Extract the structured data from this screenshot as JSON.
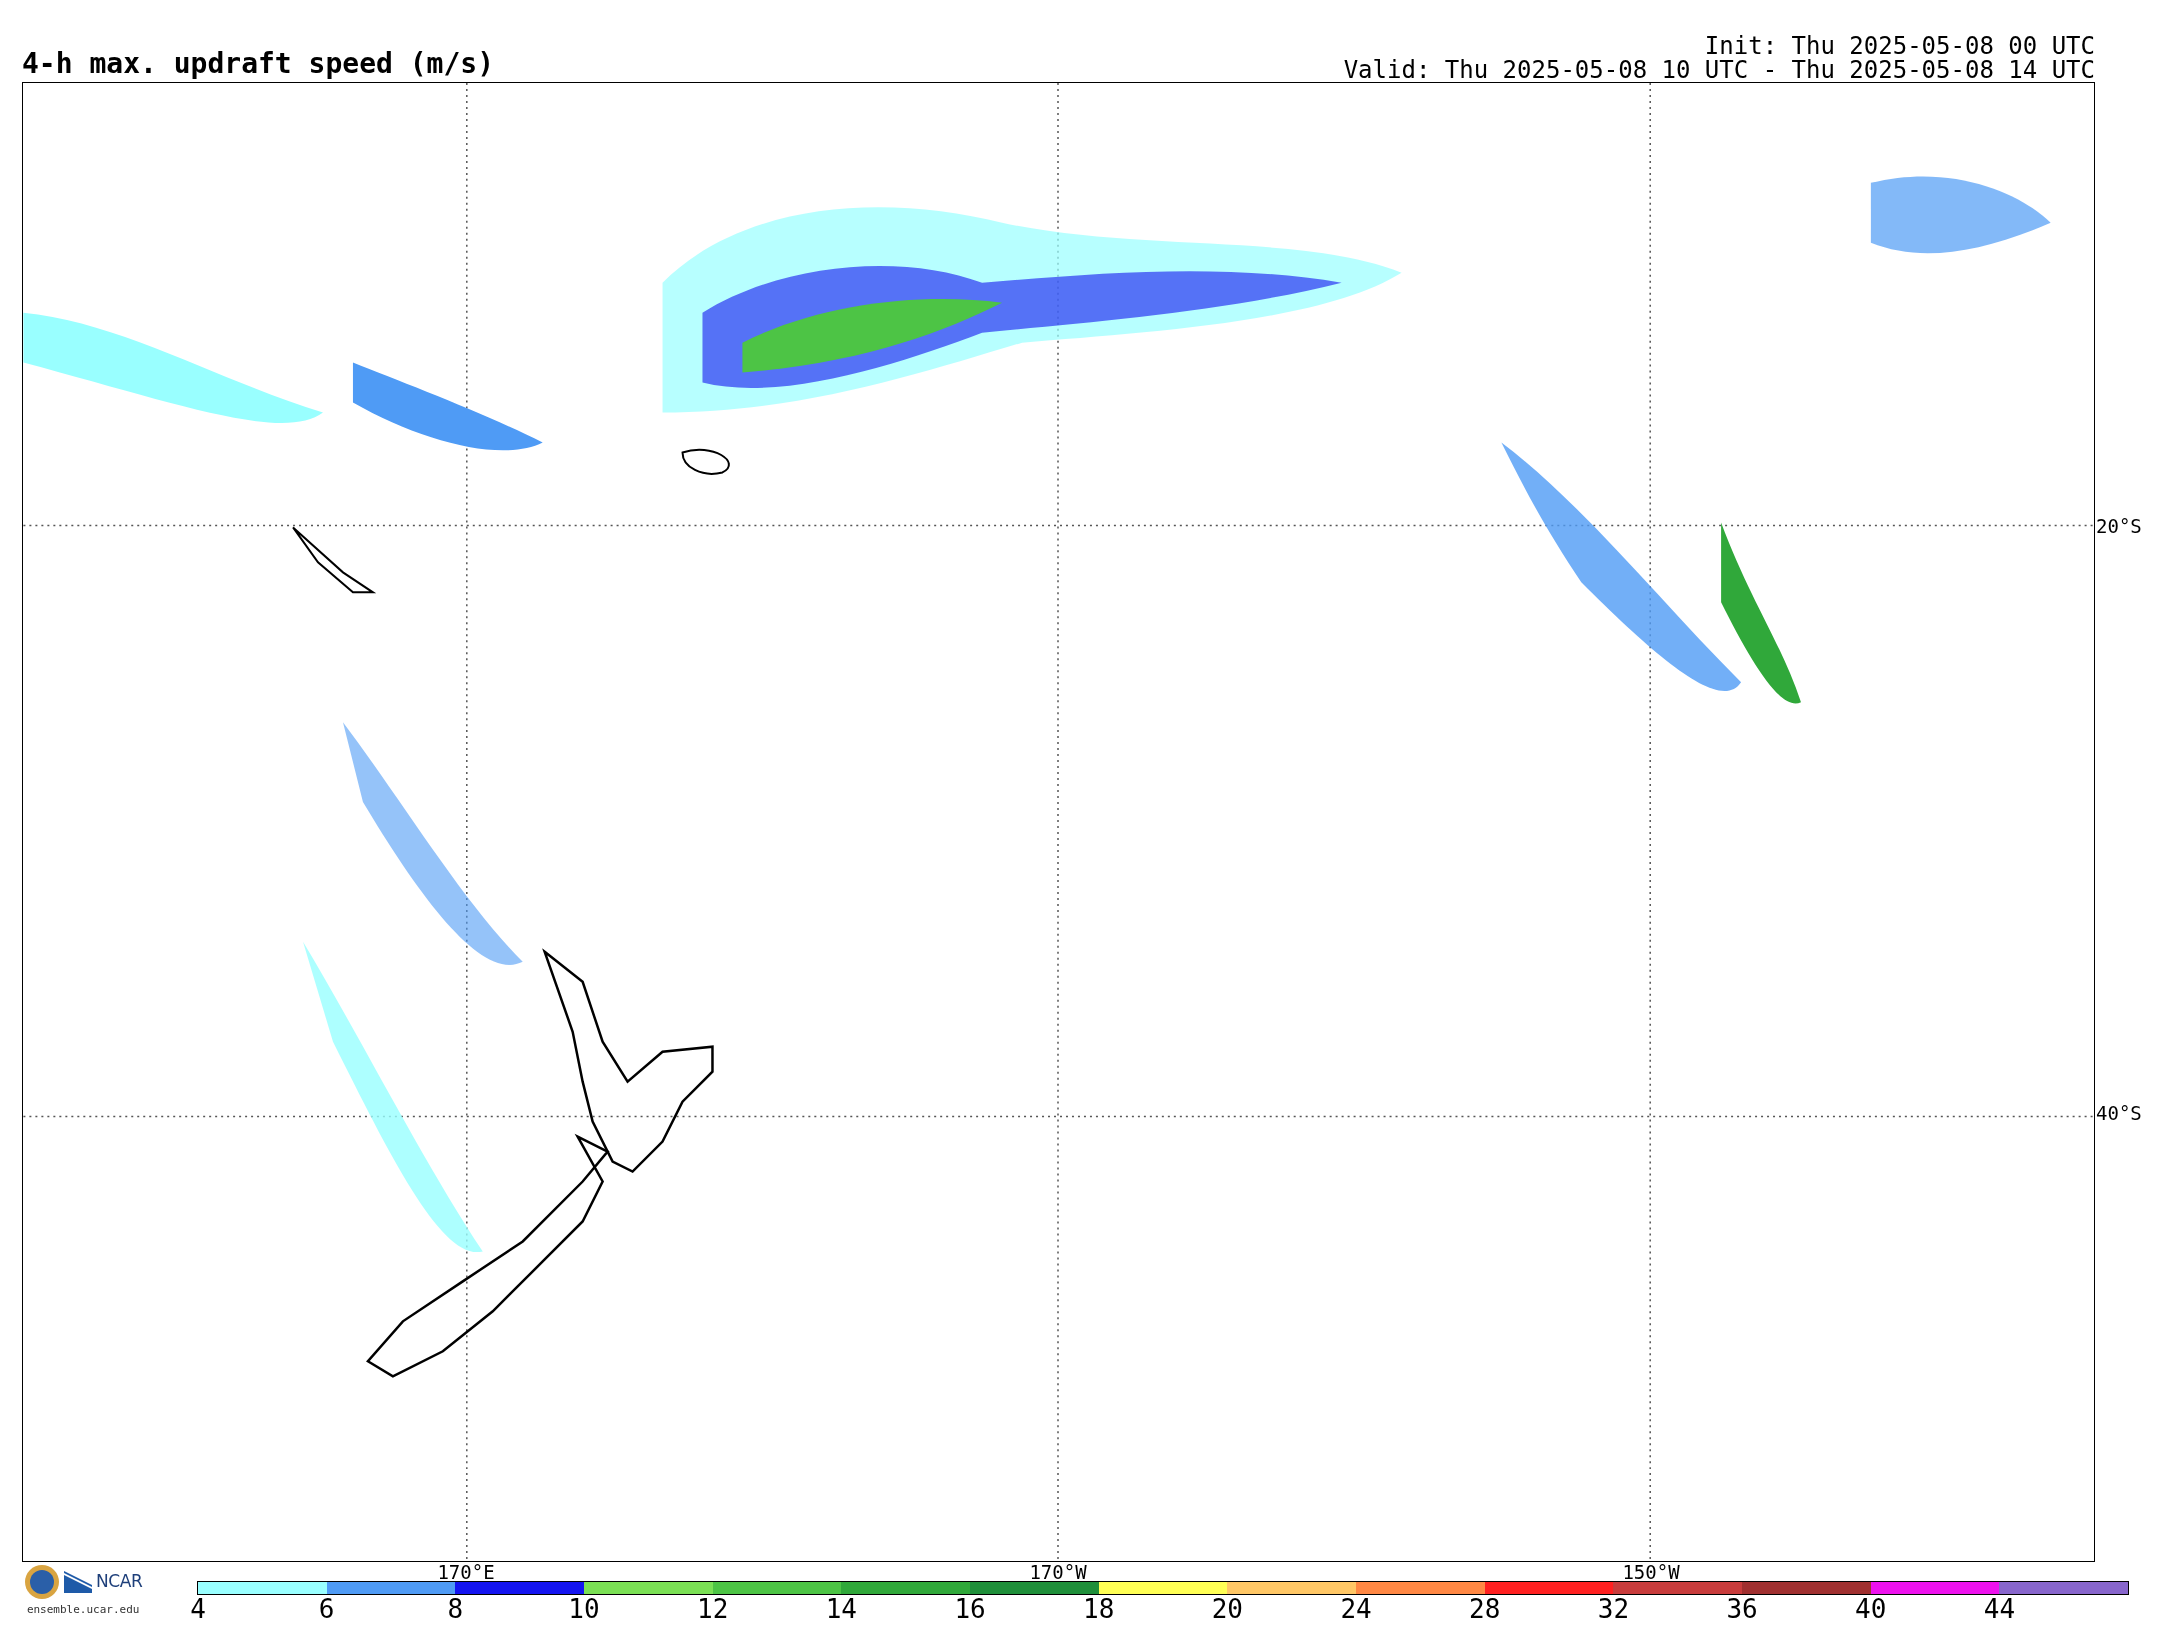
{
  "title": "4-h max. updraft speed (m/s)",
  "init": "Init: Thu 2025-05-08 00 UTC",
  "valid": "Valid: Thu 2025-05-08 10 UTC - Thu 2025-05-08 14 UTC",
  "lat_labels": [
    "20°S",
    "40°S"
  ],
  "lon_labels": [
    "170°E",
    "170°W",
    "150°W"
  ],
  "logo": {
    "text": "NCAR",
    "url": "ensemble.ucar.edu"
  },
  "colorbar": [
    {
      "label": "4",
      "color": "#99ffff"
    },
    {
      "label": "6",
      "color": "#4f9bf5"
    },
    {
      "label": "8",
      "color": "#1414f0"
    },
    {
      "label": "10",
      "color": "#7be055"
    },
    {
      "label": "12",
      "color": "#4dc445"
    },
    {
      "label": "14",
      "color": "#30a83a"
    },
    {
      "label": "16",
      "color": "#1f8f3a"
    },
    {
      "label": "18",
      "color": "#ffff55"
    },
    {
      "label": "20",
      "color": "#ffc766"
    },
    {
      "label": "24",
      "color": "#ff8844"
    },
    {
      "label": "28",
      "color": "#ff2020"
    },
    {
      "label": "32",
      "color": "#c83c3c"
    },
    {
      "label": "36",
      "color": "#a03030"
    },
    {
      "label": "40",
      "color": "#ee11ee"
    },
    {
      "label": "44",
      "color": "#8866cc"
    }
  ]
}
